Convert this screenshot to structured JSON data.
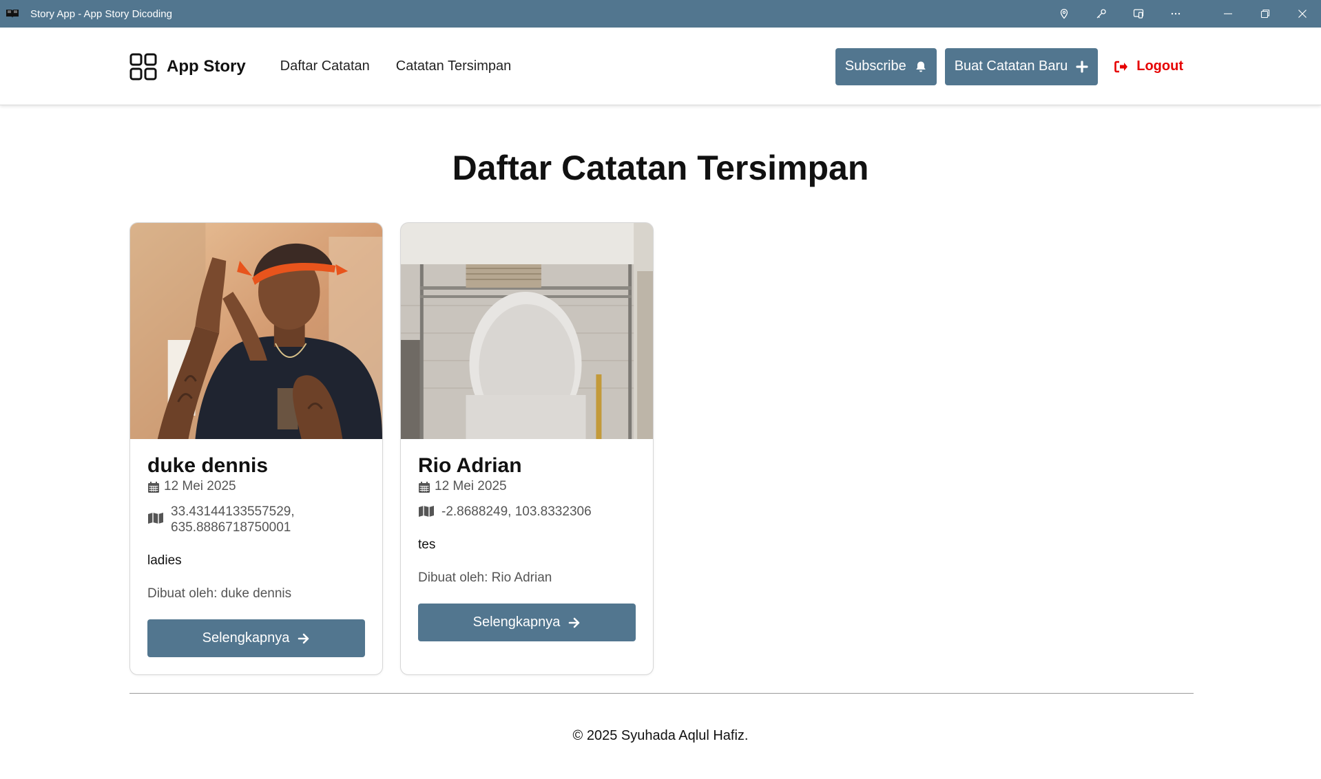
{
  "window": {
    "title": "Story App - App Story Dicoding"
  },
  "header": {
    "brand": "App Story",
    "nav": [
      {
        "label": "Daftar Catatan"
      },
      {
        "label": "Catatan Tersimpan"
      }
    ],
    "subscribe_label": "Subscribe",
    "new_story_label": "Buat Catatan Baru",
    "logout_label": "Logout"
  },
  "main": {
    "title": "Daftar Catatan Tersimpan",
    "cards": [
      {
        "name": "duke dennis",
        "date": "12 Mei 2025",
        "coord_line1": "33.43144133557529,",
        "coord_line2": "635.8886718750001",
        "description": "ladies",
        "author": "Dibuat oleh: duke dennis",
        "button": "Selengkapnya"
      },
      {
        "name": "Rio Adrian",
        "date": "12 Mei 2025",
        "coord_line1": "-2.8688249, 103.8332306",
        "description": "tes",
        "author": "Dibuat oleh: Rio Adrian",
        "button": "Selengkapnya"
      }
    ]
  },
  "footer": {
    "text": "© 2025 Syuhada Aqlul Hafiz."
  },
  "colors": {
    "titlebar": "#52768f",
    "primary": "#52768f",
    "logout": "#e60000"
  }
}
